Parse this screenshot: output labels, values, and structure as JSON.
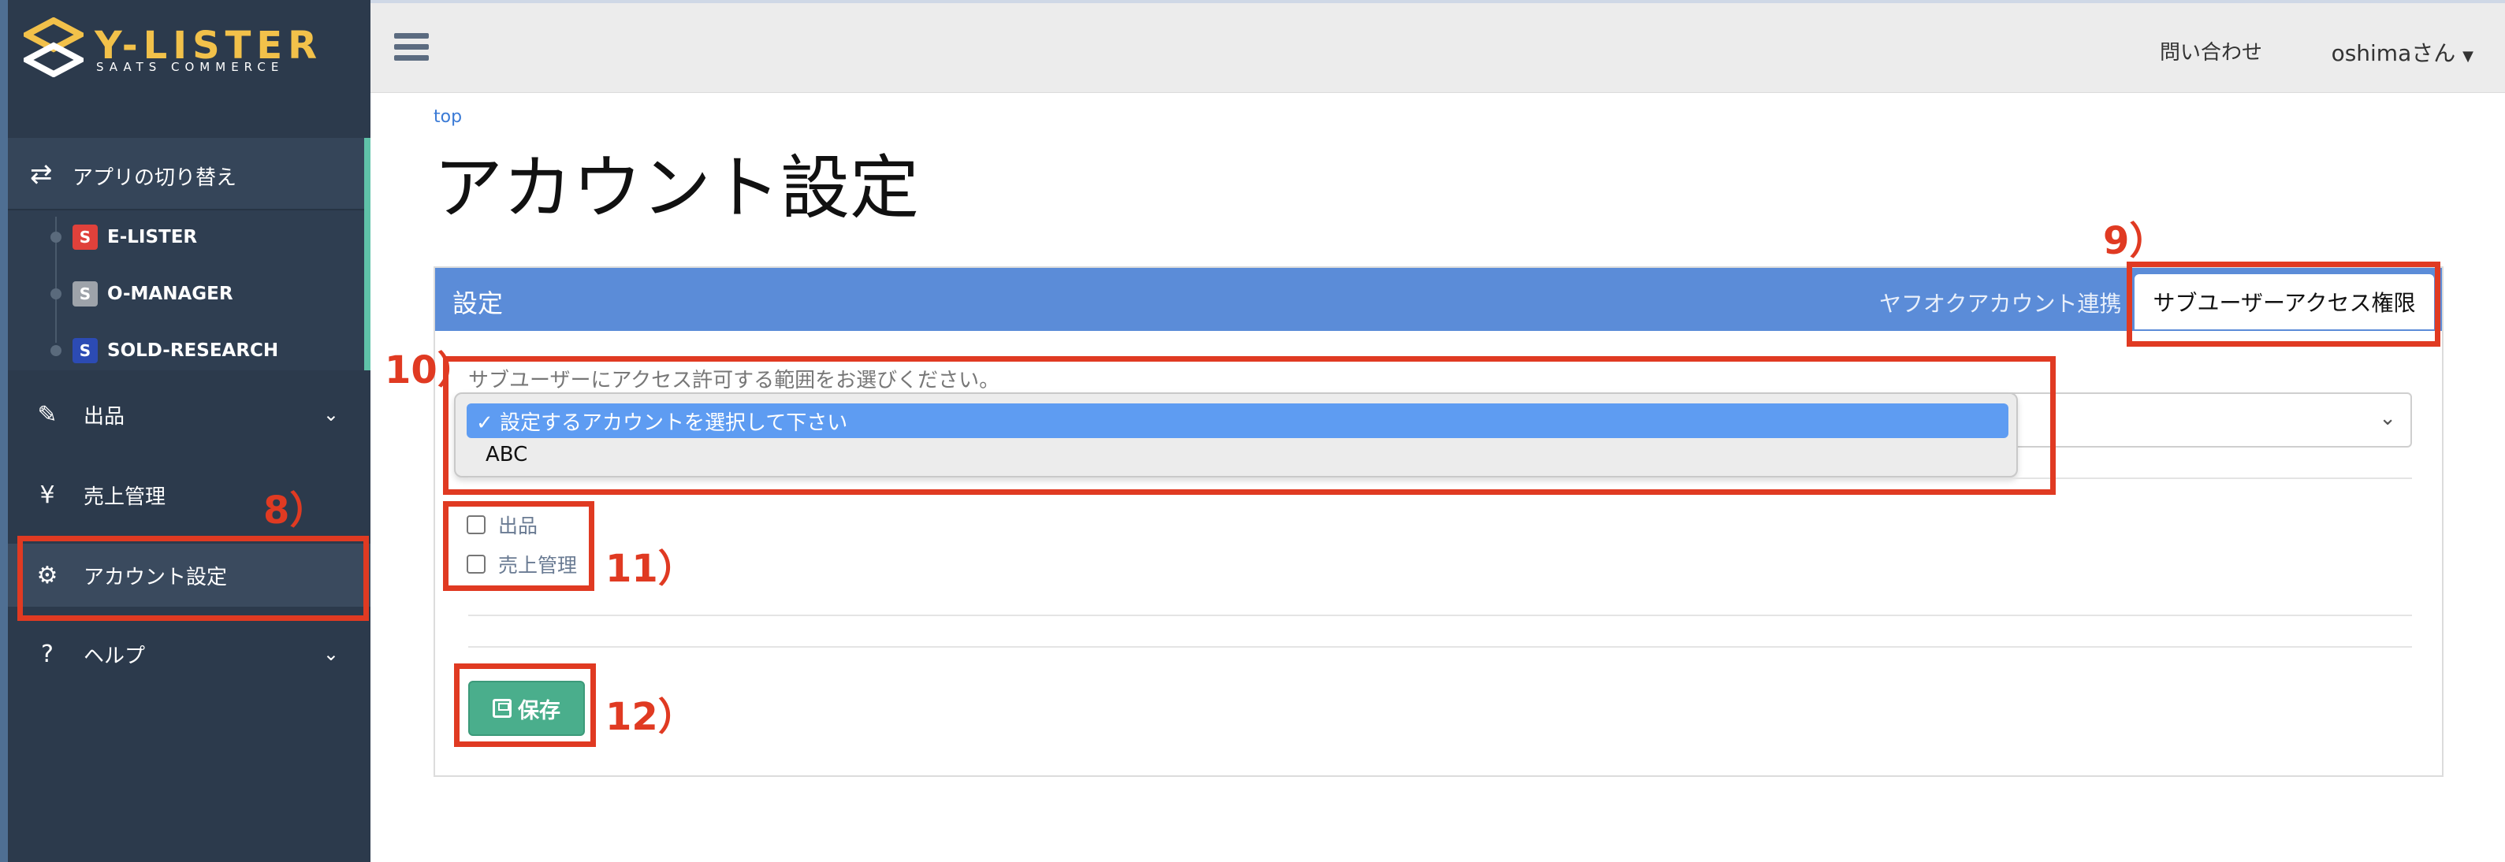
{
  "logo": {
    "title": "Y-LISTER",
    "subtitle": "SAATS COMMERCE"
  },
  "sidebar": {
    "switch_label": "アプリの切り替え",
    "apps": [
      {
        "label": "E-LISTER",
        "color": "#e0413b"
      },
      {
        "label": "O-MANAGER",
        "color": "#9ea3aa"
      },
      {
        "label": "SOLD-RESEARCH",
        "color": "#2c4bb4"
      }
    ],
    "menu": [
      {
        "label": "出品",
        "icon": "edit-icon"
      },
      {
        "label": "売上管理",
        "icon": "yen-icon"
      },
      {
        "label": "アカウント設定",
        "icon": "gear-icon"
      },
      {
        "label": "ヘルプ",
        "icon": "help-icon"
      }
    ]
  },
  "topbar": {
    "contact": "問い合わせ",
    "user": "oshimaさん"
  },
  "breadcrumb": "top",
  "page_title": "アカウント設定",
  "card": {
    "title": "設定",
    "tabs": [
      "ヤフオクアカウント連携",
      "サブユーザーアクセス権限"
    ],
    "scope_label": "サブユーザーにアクセス許可する範囲をお選びください。",
    "dropdown": {
      "selected": "✓ 設定するアカウントを選択して下さい",
      "options": [
        "ABC"
      ]
    },
    "checkboxes": [
      "出品",
      "売上管理"
    ],
    "save_label": "保存"
  },
  "annotations": [
    "8）",
    "9）",
    "10）",
    "11）",
    "12）"
  ],
  "colors": {
    "sidebar_bg": "#2c3a4c",
    "header_blue": "#5b8cd8",
    "save_green": "#4aae8c",
    "annotation_red": "#e03a22"
  }
}
